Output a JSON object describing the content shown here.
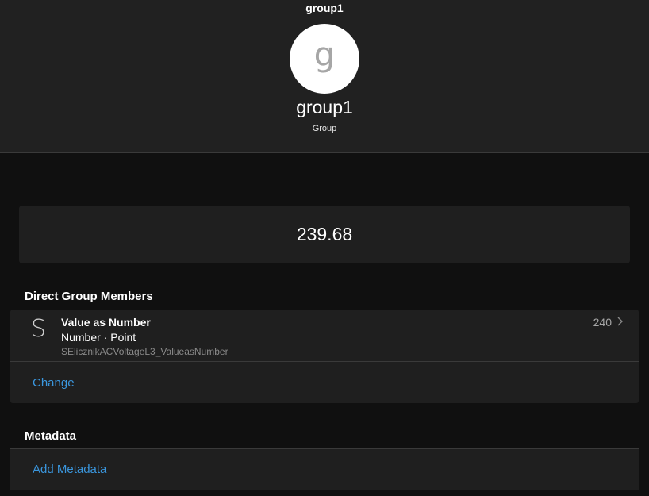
{
  "header": {
    "top_title": "group1",
    "avatar_letter": "g",
    "name": "group1",
    "type": "Group"
  },
  "value": {
    "display": "239.68"
  },
  "members": {
    "title": "Direct Group Members",
    "items": [
      {
        "icon": "S",
        "name": "Value as Number",
        "subtitle": "Number · Point",
        "id": "SElicznikACVoltageL3_ValueasNumber",
        "value": "240"
      }
    ],
    "change_label": "Change"
  },
  "metadata": {
    "title": "Metadata",
    "add_label": "Add Metadata"
  },
  "colors": {
    "accent": "#3a96dd",
    "background": "#101010",
    "card": "#1f1f1f",
    "header": "#212121"
  }
}
